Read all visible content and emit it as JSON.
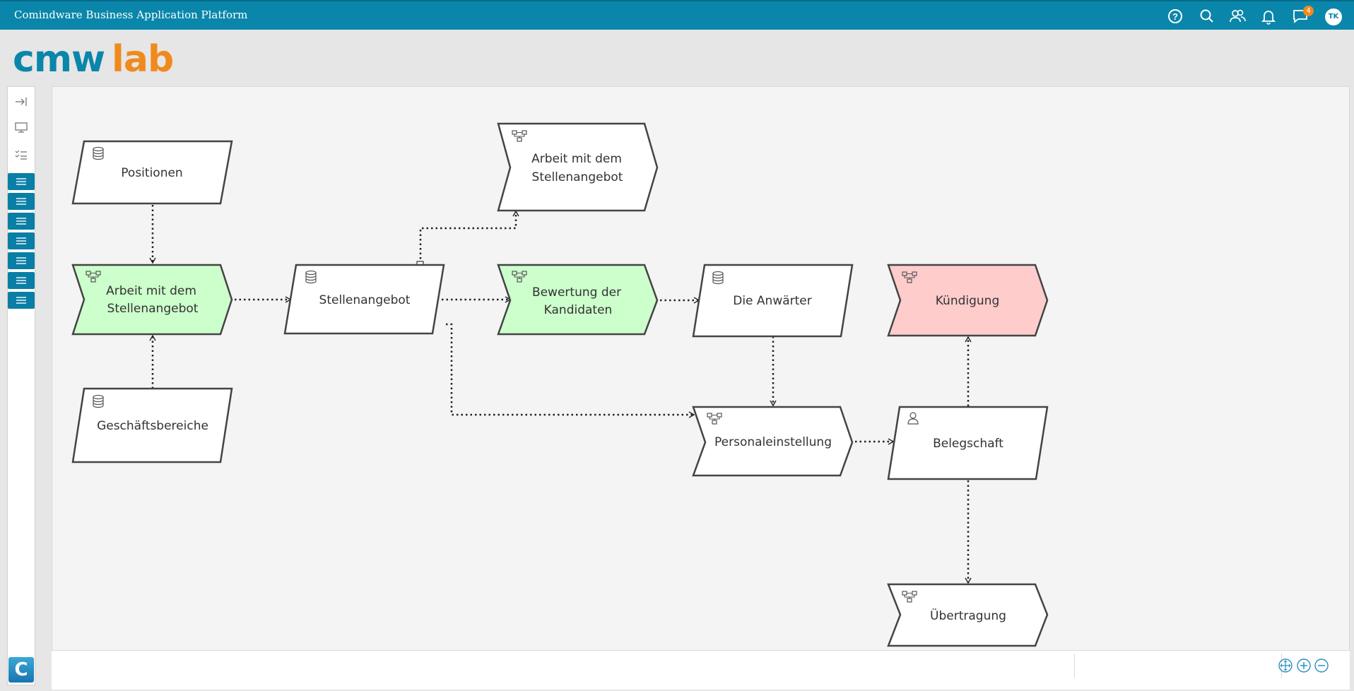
{
  "header": {
    "title": "Comindware Business Application Platform",
    "notification_count": "4",
    "user_initials": "TK"
  },
  "logo": {
    "part1": "cmw",
    "part2": "lab"
  },
  "sidebar": {
    "bottom_logo": "C",
    "buttons_count_note": ""
  },
  "diagram": {
    "nodes": {
      "positionen": "Positionen",
      "arbeit_top_1": "Arbeit mit dem",
      "arbeit_top_2": "Stellenangebot",
      "arbeit_left_1": "Arbeit mit dem",
      "arbeit_left_2": "Stellenangebot",
      "stellenangebot": "Stellenangebot",
      "bewertung_1": "Bewertung der",
      "bewertung_2": "Kandidaten",
      "anwaerter": "Die Anwärter",
      "kuendigung": "Kündigung",
      "geschaeftsbereiche": "Geschäftsbereiche",
      "personaleinstellung": "Personaleinstellung",
      "belegschaft": "Belegschaft",
      "uebertragung": "Übertragung"
    }
  },
  "colors": {
    "header_bg": "#0a86aa",
    "green_node": "#ccffcc",
    "red_node": "#ffcccc",
    "accent_orange": "#f08a1c"
  }
}
